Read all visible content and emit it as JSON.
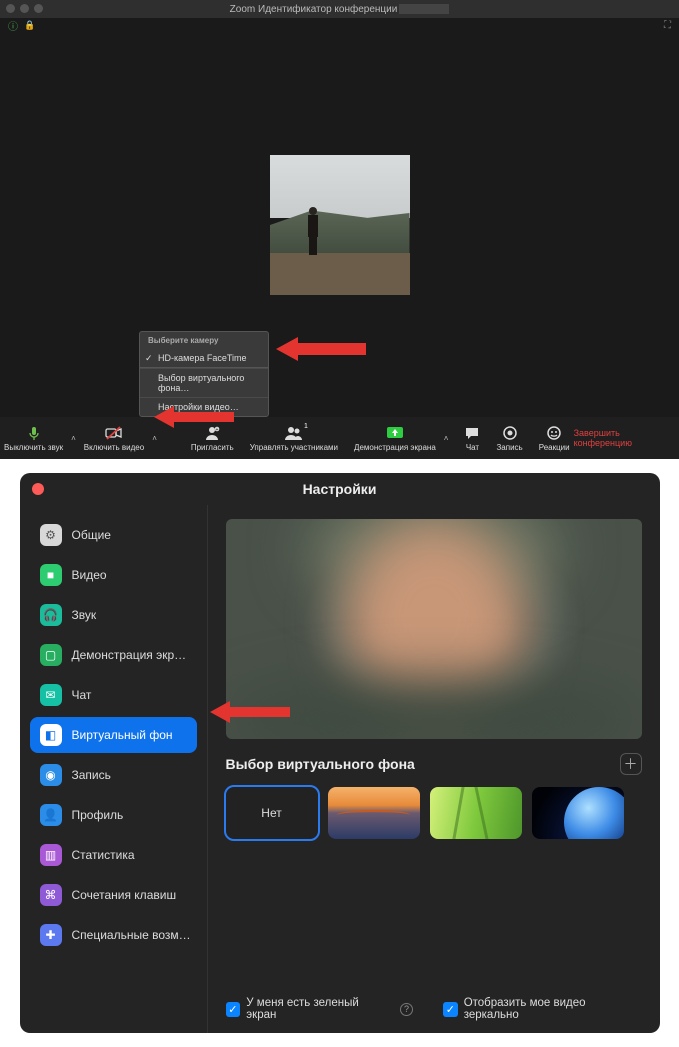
{
  "meeting": {
    "title": "Zoom Идентификатор конференции",
    "camera_menu": {
      "header": "Выберите камеру",
      "items": [
        {
          "label": "HD-камера FaceTime",
          "checked": true
        },
        {
          "label": "Выбор виртуального фона…",
          "checked": false
        },
        {
          "label": "Настройки видео…",
          "checked": false
        }
      ]
    },
    "controls": {
      "mute": "Выключить звук",
      "video": "Включить видео",
      "invite": "Пригласить",
      "participants": "Управлять участниками",
      "participants_count": "1",
      "share": "Демонстрация экрана",
      "chat": "Чат",
      "record": "Запись",
      "reactions": "Реакции",
      "end": "Завершить конференцию"
    }
  },
  "settings": {
    "title": "Настройки",
    "sidebar": [
      {
        "label": "Общие",
        "icon": "⚙",
        "bg": "#d8d8d8",
        "fg": "#555"
      },
      {
        "label": "Видео",
        "icon": "■",
        "bg": "#2ecc71",
        "fg": "#fff"
      },
      {
        "label": "Звук",
        "icon": "🎧",
        "bg": "#1abc9c",
        "fg": "#fff"
      },
      {
        "label": "Демонстрация экр…",
        "icon": "▢",
        "bg": "#27ae60",
        "fg": "#fff"
      },
      {
        "label": "Чат",
        "icon": "✉",
        "bg": "#16c0a4",
        "fg": "#fff"
      },
      {
        "label": "Виртуальный фон",
        "icon": "◧",
        "bg": "#fff",
        "fg": "#0e72ed",
        "active": true
      },
      {
        "label": "Запись",
        "icon": "◉",
        "bg": "#2b8de8",
        "fg": "#fff"
      },
      {
        "label": "Профиль",
        "icon": "👤",
        "bg": "#2b8de8",
        "fg": "#fff"
      },
      {
        "label": "Статистика",
        "icon": "▥",
        "bg": "#aa59d6",
        "fg": "#fff"
      },
      {
        "label": "Сочетания клавиш",
        "icon": "⌘",
        "bg": "#8e5ad6",
        "fg": "#fff"
      },
      {
        "label": "Специальные возм…",
        "icon": "✚",
        "bg": "#5c79f0",
        "fg": "#fff"
      }
    ],
    "section_title": "Выбор виртуального фона",
    "bg_none": "Нет",
    "checkbox_green": "У меня есть зеленый экран",
    "checkbox_mirror": "Отобразить мое видео зеркально"
  }
}
